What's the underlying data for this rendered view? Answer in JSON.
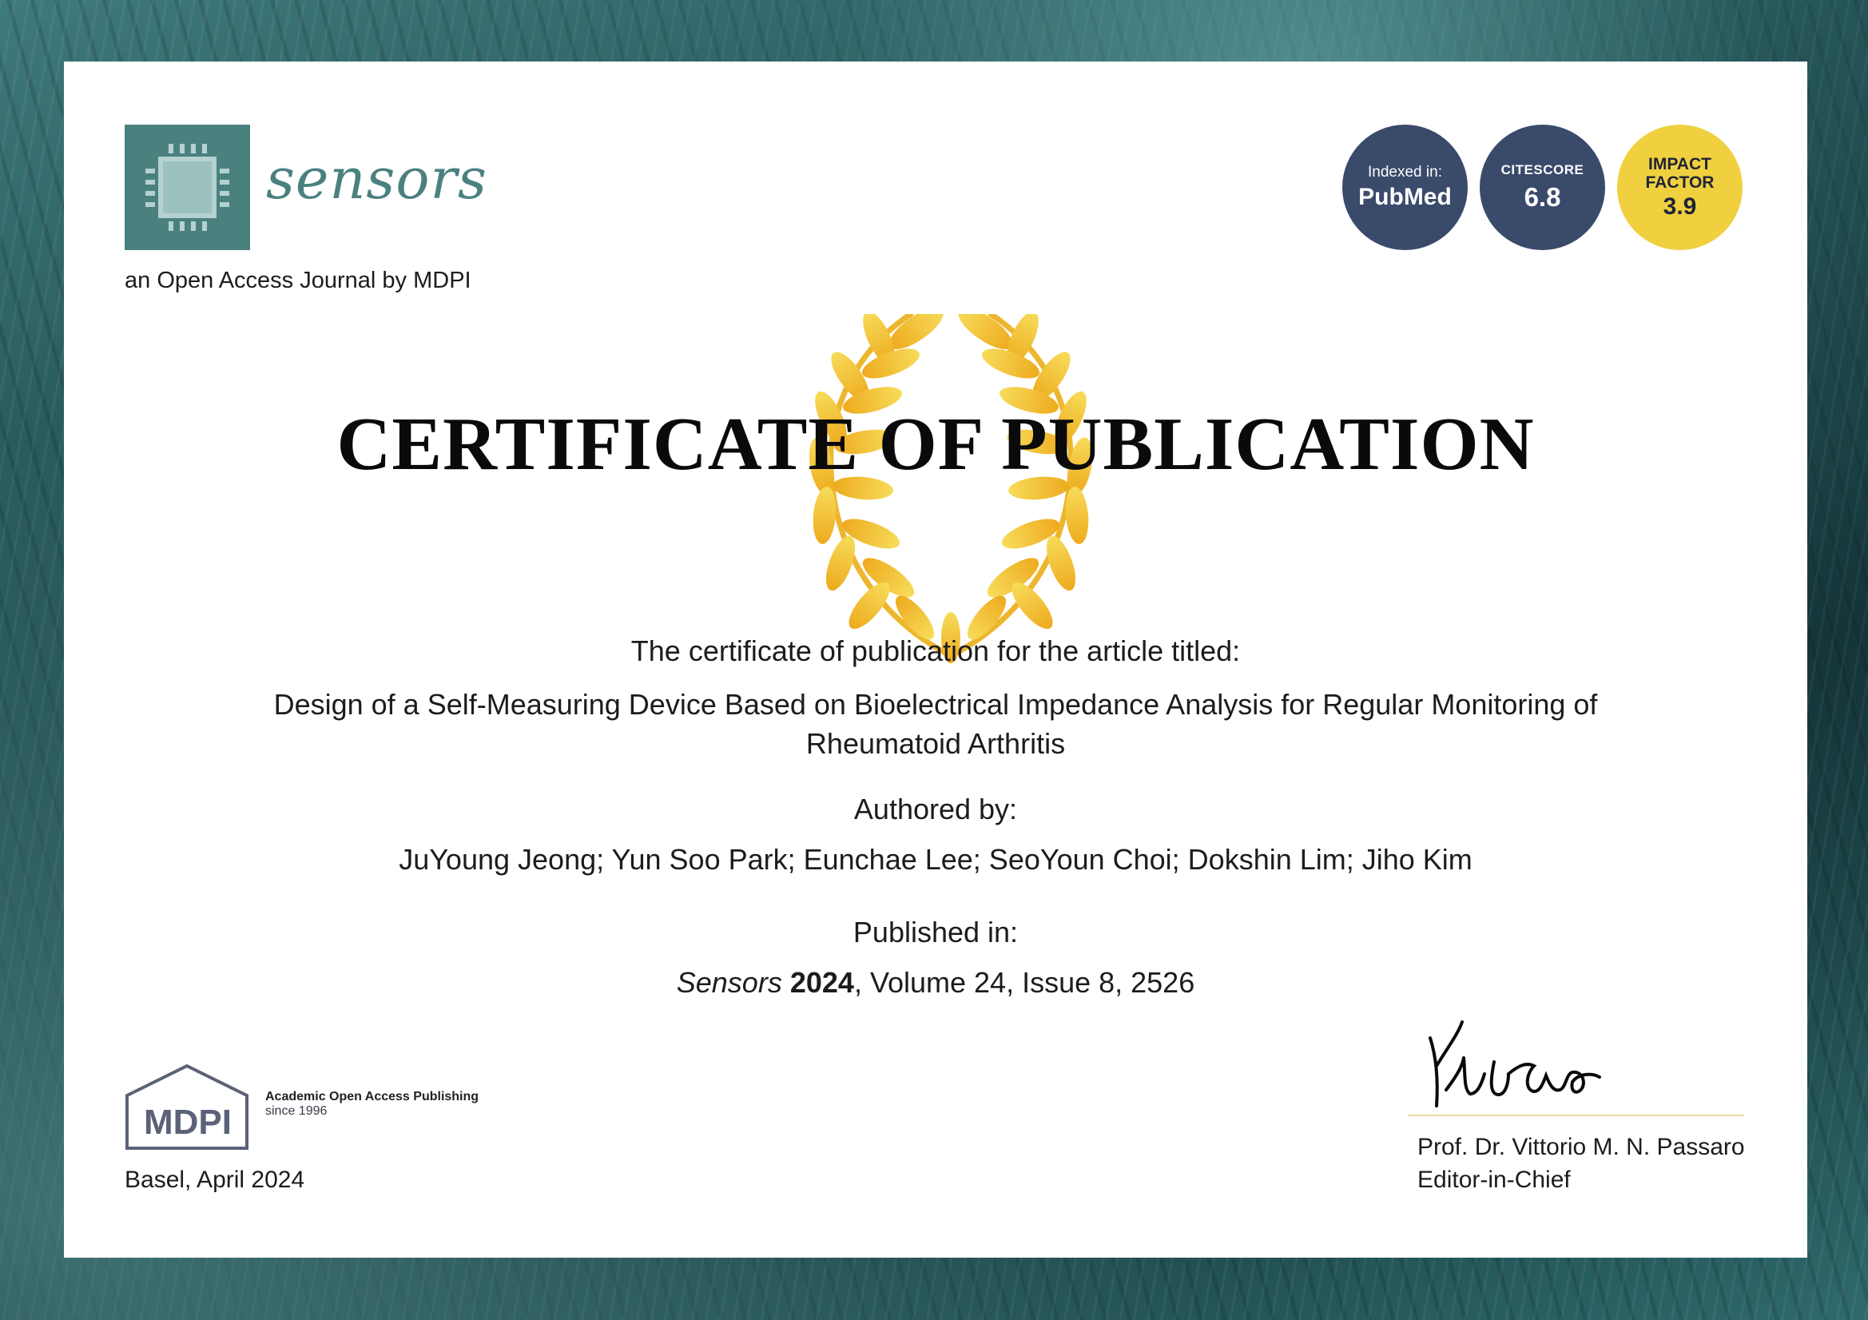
{
  "journal": {
    "name": "sensors",
    "tagline": "an Open Access Journal by MDPI",
    "brand_color": "#4a817f",
    "logo_icon": "microchip-icon"
  },
  "badges": {
    "indexed_label": "Indexed in:",
    "indexed_value": "PubMed",
    "citescore_label": "CITESCORE",
    "citescore_value": "6.8",
    "impact_label_1": "IMPACT",
    "impact_label_2": "FACTOR",
    "impact_value": "3.9",
    "navy_color": "#3a4a6b",
    "yellow_color": "#f0d03f"
  },
  "certificate": {
    "title": "CERTIFICATE OF PUBLICATION",
    "decoration": "laurel-wreath-icon",
    "intro": "The certificate of publication for the article titled:",
    "article_title": "Design of a Self-Measuring Device Based on Bioelectrical Impedance Analysis for Regular Monitoring of Rheumatoid Arthritis",
    "authored_label": "Authored by:",
    "authors": "JuYoung Jeong; Yun Soo Park; Eunchae Lee; SeoYoun Choi; Dokshin Lim; Jiho Kim",
    "published_label": "Published in:",
    "pub_journal": "Sensors",
    "pub_year": "2024",
    "pub_rest": ", Volume 24, Issue 8, 2526"
  },
  "footer": {
    "publisher_logo_text": "MDPI",
    "publisher_tagline": "Academic Open Access Publishing",
    "publisher_since": "since 1996",
    "place_date": "Basel, April 2024",
    "signer_name": "Prof. Dr. Vittorio M. N. Passaro",
    "signer_role": "Editor-in-Chief"
  }
}
